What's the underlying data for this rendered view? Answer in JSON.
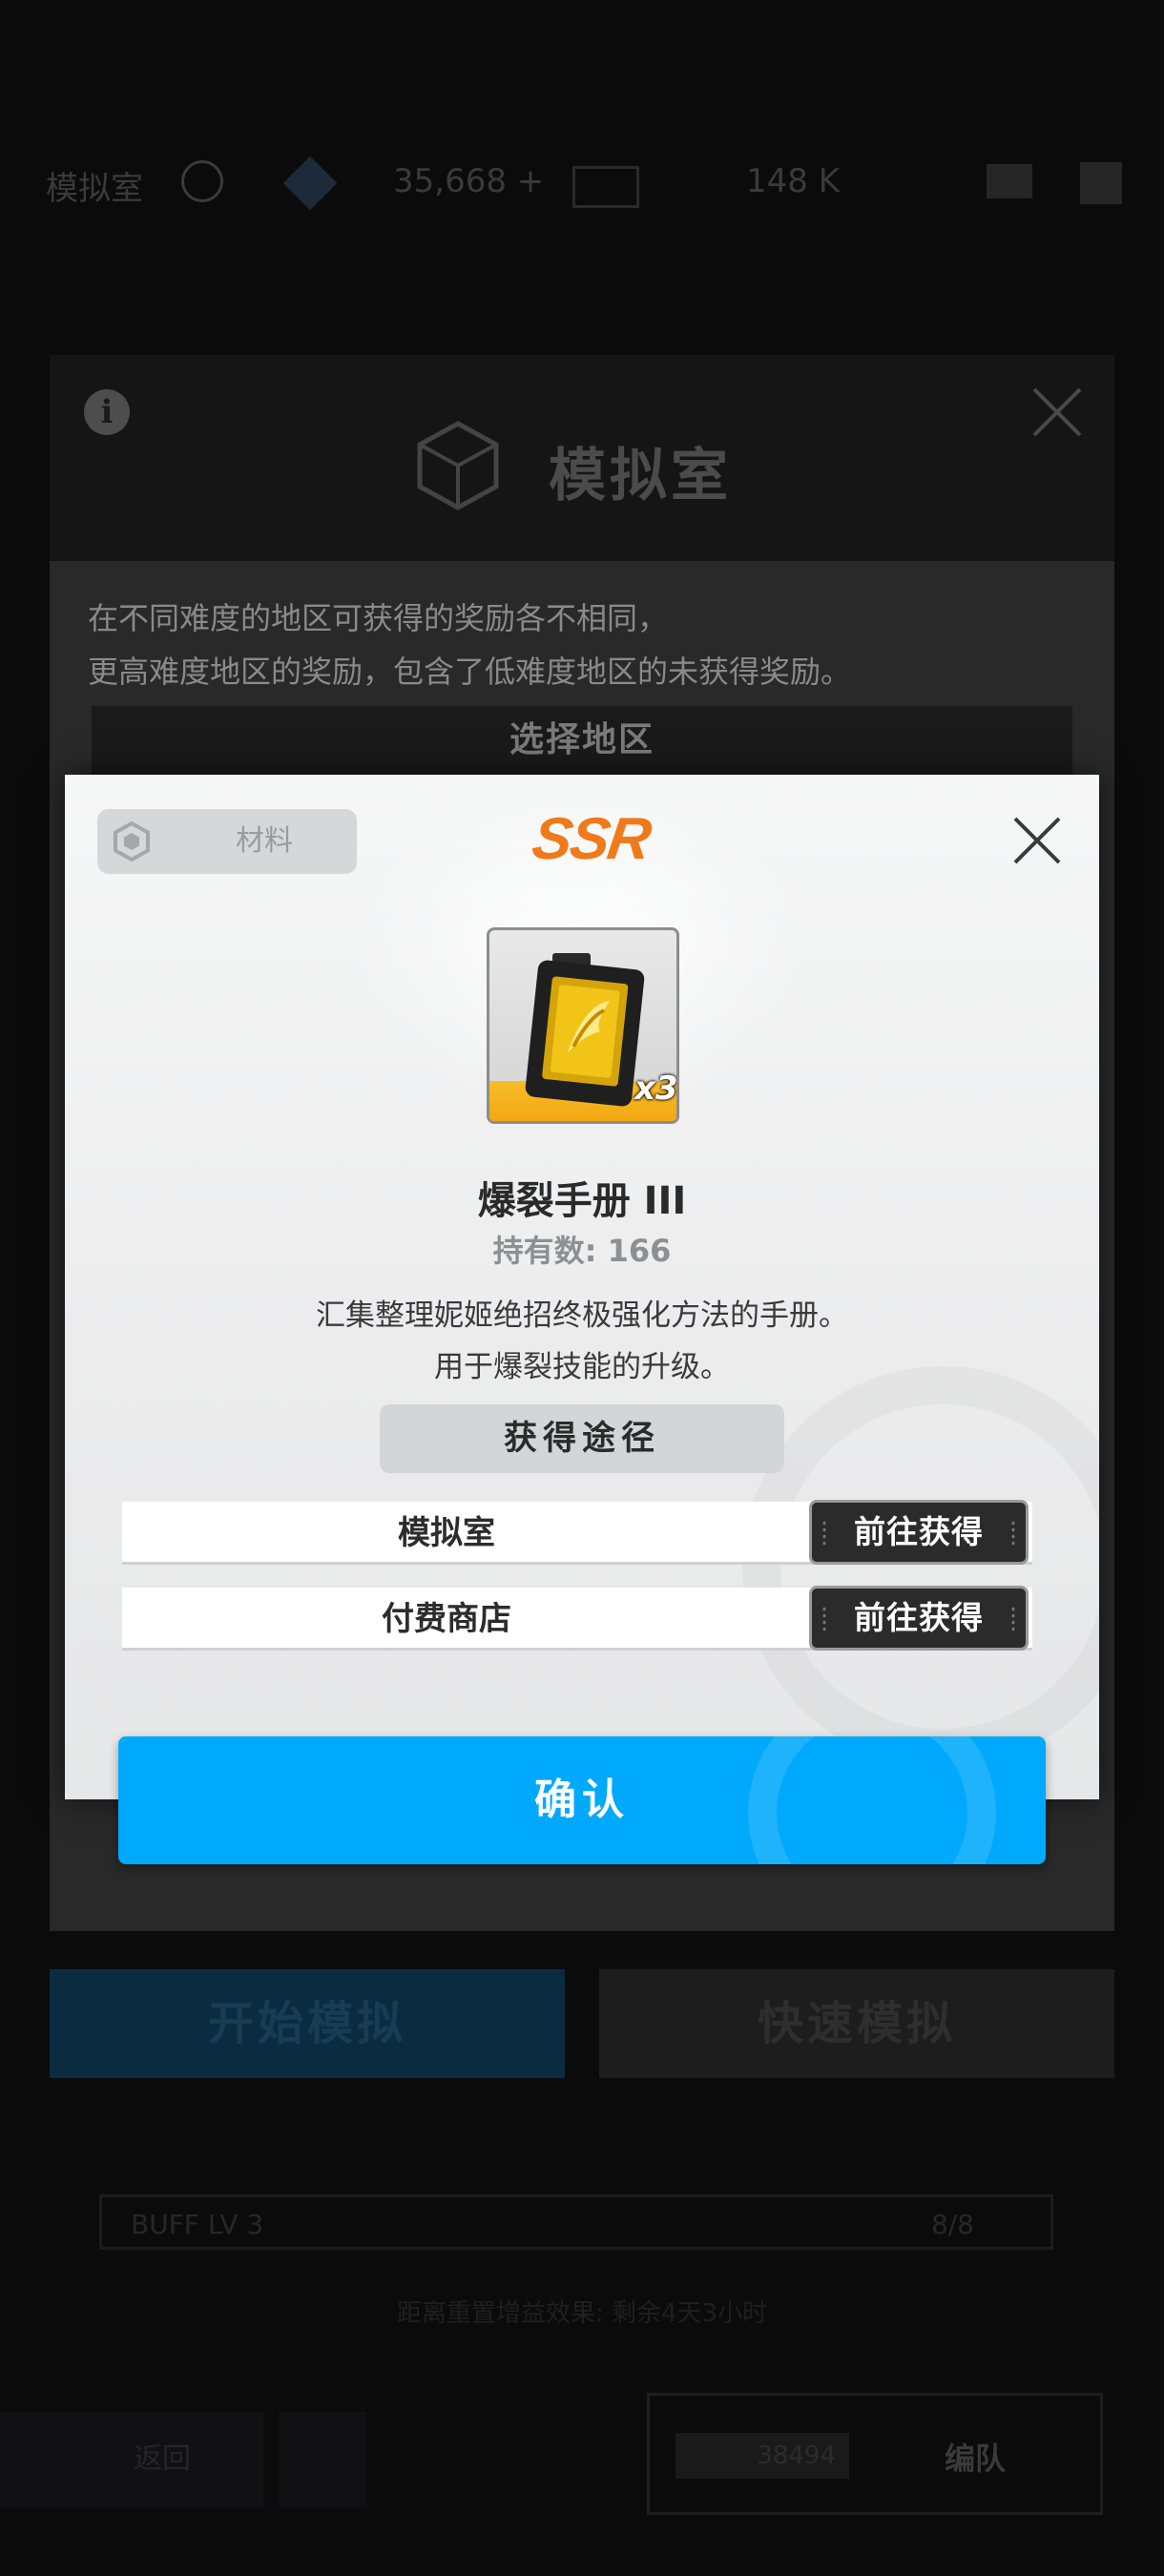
{
  "background": {
    "topbar": {
      "location": "模拟室",
      "currency_1": "35,668 +",
      "currency_2": "148 K"
    },
    "panel": {
      "title": "模拟室",
      "description_line1": "在不同难度的地区可获得的奖励各不相同，",
      "description_line2": "更高难度地区的奖励，包含了低难度地区的未获得奖励。",
      "select_region": "选择地区"
    },
    "buttons": {
      "start": "开始模拟",
      "quick": "快速模拟"
    },
    "buff": {
      "label": "BUFF LV 3",
      "count": "8/8",
      "note": "距离重置增益效果: 剩余4天3小时"
    },
    "bottom": {
      "back": "返回",
      "power": "38494",
      "formation": "编队"
    }
  },
  "modal": {
    "category": "材料",
    "rarity": "SSR",
    "item": {
      "name": "爆裂手册 III",
      "quantity_badge": "x3",
      "owned": "持有数: 166",
      "description_line1": "汇集整理妮姬绝招终极强化方法的手册。",
      "description_line2": "用于爆裂技能的升级。"
    },
    "sources_header": "获得途径",
    "sources": [
      {
        "name": "模拟室",
        "action": "前往获得"
      },
      {
        "name": "付费商店",
        "action": "前往获得"
      }
    ],
    "confirm": "确认"
  },
  "colors": {
    "accent_blue": "#00a9fb",
    "rarity_orange": "#f07a1a",
    "item_gold": "#f2a40e"
  },
  "icons": [
    "close-icon",
    "info-icon",
    "cube-icon",
    "material-icon",
    "burst-manual-icon"
  ]
}
